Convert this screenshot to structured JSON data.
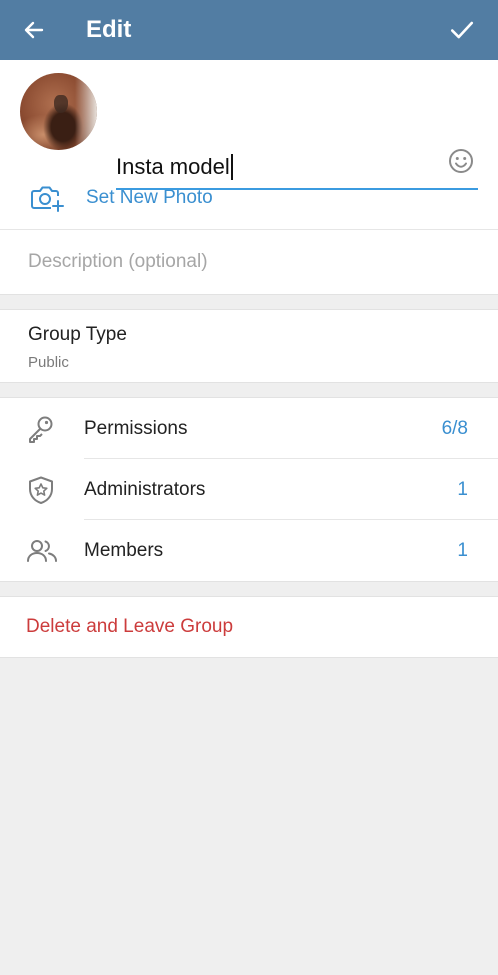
{
  "header": {
    "title": "Edit",
    "back_icon": "arrow-left-icon",
    "confirm_icon": "checkmark-icon",
    "bar_color": "#527da3"
  },
  "group": {
    "name_value": "Insta model",
    "emoji_icon": "smiley-icon",
    "set_photo_label": "Set New Photo",
    "camera_icon": "camera-add-icon",
    "description_placeholder": "Description (optional)"
  },
  "group_type": {
    "title": "Group Type",
    "value": "Public"
  },
  "settings": {
    "items": [
      {
        "label": "Permissions",
        "value": "6/8",
        "icon": "key-icon"
      },
      {
        "label": "Administrators",
        "value": "1",
        "icon": "shield-star-icon"
      },
      {
        "label": "Members",
        "value": "1",
        "icon": "people-icon"
      }
    ]
  },
  "danger": {
    "delete_label": "Delete and Leave Group",
    "color": "#cc3c3c"
  },
  "accent_color": "#3a8fd0"
}
